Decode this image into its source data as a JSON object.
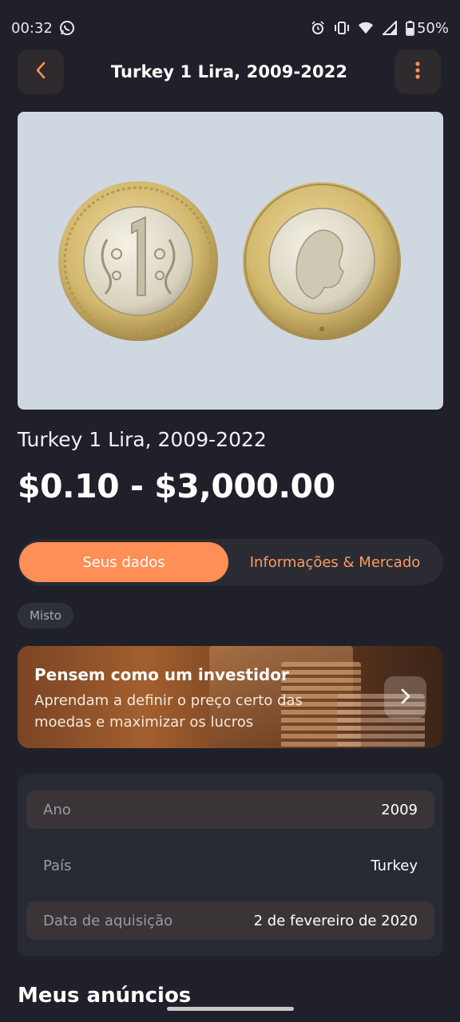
{
  "status_bar": {
    "time": "00:32",
    "battery": "50%",
    "icons": [
      "whatsapp-icon",
      "alarm-icon",
      "vibrate-icon",
      "wifi-icon",
      "signal-icon",
      "battery-icon"
    ]
  },
  "header": {
    "title": "Turkey 1 Lira, 2009-2022",
    "back_icon": "chevron-left-icon",
    "menu_icon": "more-vertical-icon"
  },
  "coin": {
    "name": "Turkey 1 Lira, 2009-2022",
    "price_range": "$0.10 - $3,000.00",
    "image": "coin-obverse-reverse"
  },
  "tabs": [
    {
      "label": "Seus dados",
      "active": true
    },
    {
      "label": "Informações & Mercado",
      "active": false
    }
  ],
  "tag": "Misto",
  "banner": {
    "title": "Pensem como um investidor",
    "text": "Aprendam a definir o preço certo das moedas e maximizar os lucros",
    "button_icon": "chevron-right-icon"
  },
  "details": [
    {
      "label": "Ano",
      "value": "2009"
    },
    {
      "label": "País",
      "value": "Turkey"
    },
    {
      "label": "Data de aquisição",
      "value": "2 de fevereiro de 2020"
    }
  ],
  "section_title": "Meus anúncios",
  "colors": {
    "background": "#1f2029",
    "accent": "#ff8f56",
    "accent_text": "#ff9a61",
    "card": "#282a33"
  }
}
